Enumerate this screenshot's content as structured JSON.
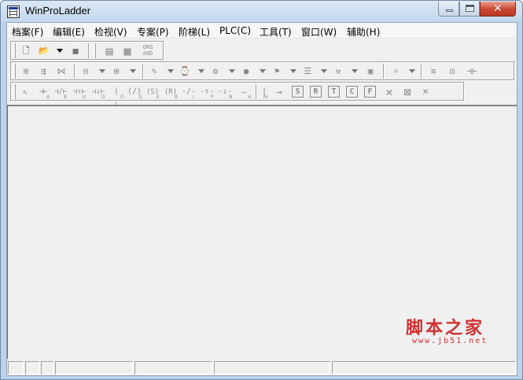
{
  "window": {
    "title": "WinProLadder",
    "close_glyph": "✕"
  },
  "menu": [
    {
      "label": "档案(F)"
    },
    {
      "label": "编辑(E)"
    },
    {
      "label": "检视(V)"
    },
    {
      "label": "专案(P)"
    },
    {
      "label": "阶梯(L)"
    },
    {
      "label": "PLC(C)"
    },
    {
      "label": "工具(T)"
    },
    {
      "label": "窗口(W)"
    },
    {
      "label": "辅助(H)"
    }
  ],
  "toolbar1": {
    "items": [
      {
        "icon": "new-file-icon",
        "glyph": "🗋"
      },
      {
        "icon": "open-folder-icon",
        "glyph": "📂"
      },
      {
        "icon": "save-icon",
        "glyph": "▪"
      },
      {
        "icon": "ladder-view-icon",
        "glyph": "▤"
      },
      {
        "icon": "monitor-view-icon",
        "glyph": "▦"
      }
    ],
    "org_label": "ORG",
    "and_label": "AND"
  },
  "toolbar2": {
    "icons": [
      "rung-insert-icon",
      "row-insert-icon",
      "row-delete-icon",
      "block-icon",
      "block2-icon",
      "edit-icon",
      "timer-icon",
      "run-icon",
      "stop-icon",
      "forcing-icon",
      "list-icon",
      "register-icon",
      "calendar-icon",
      "find-icon",
      "step-icon",
      "compare-icon"
    ]
  },
  "toolbar3": {
    "contacts": [
      {
        "name": "select-cursor-icon",
        "glyph": "↖",
        "sub": ""
      },
      {
        "name": "contact-a-icon",
        "glyph": "⊣⊢",
        "sub": "A"
      },
      {
        "name": "contact-b-icon",
        "glyph": "⊣/⊢",
        "sub": "B"
      },
      {
        "name": "contact-up-icon",
        "glyph": "⊣↑⊢",
        "sub": "U"
      },
      {
        "name": "contact-down-icon",
        "glyph": "⊣↓⊢",
        "sub": "D"
      },
      {
        "name": "coil-out-icon",
        "glyph": "( )",
        "sub": "O"
      },
      {
        "name": "coil-not-icon",
        "glyph": "(/)",
        "sub": "Q"
      },
      {
        "name": "coil-set-icon",
        "glyph": "(S)",
        "sub": "E"
      },
      {
        "name": "coil-reset-icon",
        "glyph": "(R)",
        "sub": "R"
      },
      {
        "name": "invert-icon",
        "glyph": "-/-",
        "sub": "I"
      },
      {
        "name": "pulse-up-icon",
        "glyph": "-↑-",
        "sub": "P"
      },
      {
        "name": "pulse-down-icon",
        "glyph": "-↓-",
        "sub": "N"
      },
      {
        "name": "horizontal-line-icon",
        "glyph": "—",
        "sub": "H"
      },
      {
        "name": "vertical-line-icon",
        "glyph": "|",
        "sub": "V"
      },
      {
        "name": "arrow-right-icon",
        "glyph": "→",
        "sub": ""
      }
    ],
    "boxed": [
      {
        "name": "s-function-icon",
        "glyph": "S"
      },
      {
        "name": "r-function-icon",
        "glyph": "R"
      },
      {
        "name": "t-function-icon",
        "glyph": "T"
      },
      {
        "name": "c-function-icon",
        "glyph": "C"
      },
      {
        "name": "f-function-icon",
        "glyph": "F"
      }
    ],
    "deletes": [
      {
        "name": "delete-icon",
        "glyph": "✕"
      },
      {
        "name": "delete-row-icon",
        "glyph": "⊠"
      },
      {
        "name": "delete-column-icon",
        "glyph": "✕"
      }
    ]
  },
  "watermark": {
    "main": "脚本之家",
    "sub": "www.jb51.net"
  }
}
